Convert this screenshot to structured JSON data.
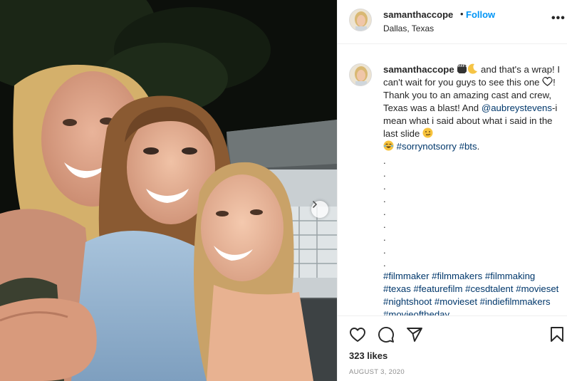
{
  "post": {
    "username": "samanthaccope",
    "follow_separator": "•",
    "follow_label": "Follow",
    "location": "Dallas, Texas",
    "more_label": "•••"
  },
  "caption": {
    "username": "samanthaccope",
    "emoji_1": "clapper-board",
    "emoji_2": "crescent-moon",
    "text_1": " and that's a wrap! I can't wait for you guys to see this one ",
    "emoji_3": "heart",
    "text_2": "! Thank you to an amazing cast and crew, Texas was a blast! And ",
    "mention": "@aubreystevens",
    "text_3": "-i mean what i said about what i said in the last slide ",
    "emoji_4": "smirk-face",
    "emoji_5": "laughing-face",
    "hashtag_1": "#sorrynotsorry",
    "hashtag_2": "#bts",
    "text_4": ".",
    "dots": [
      ".",
      ".",
      ".",
      ".",
      ".",
      ".",
      ".",
      ".",
      "."
    ],
    "hashtags": [
      "#filmmaker",
      "#filmmakers",
      "#filmmaking",
      "#texas",
      "#featurefilm",
      "#cesdtalent",
      "#movieset",
      "#nightshoot",
      "#movieset",
      "#indiefilmmakers",
      "#movieoftheday"
    ]
  },
  "actions": {
    "likes": "323 likes",
    "date": "AUGUST 3, 2020"
  },
  "colors": {
    "link": "#00376b",
    "follow": "#0095f6",
    "muted": "#8e8e8e"
  }
}
